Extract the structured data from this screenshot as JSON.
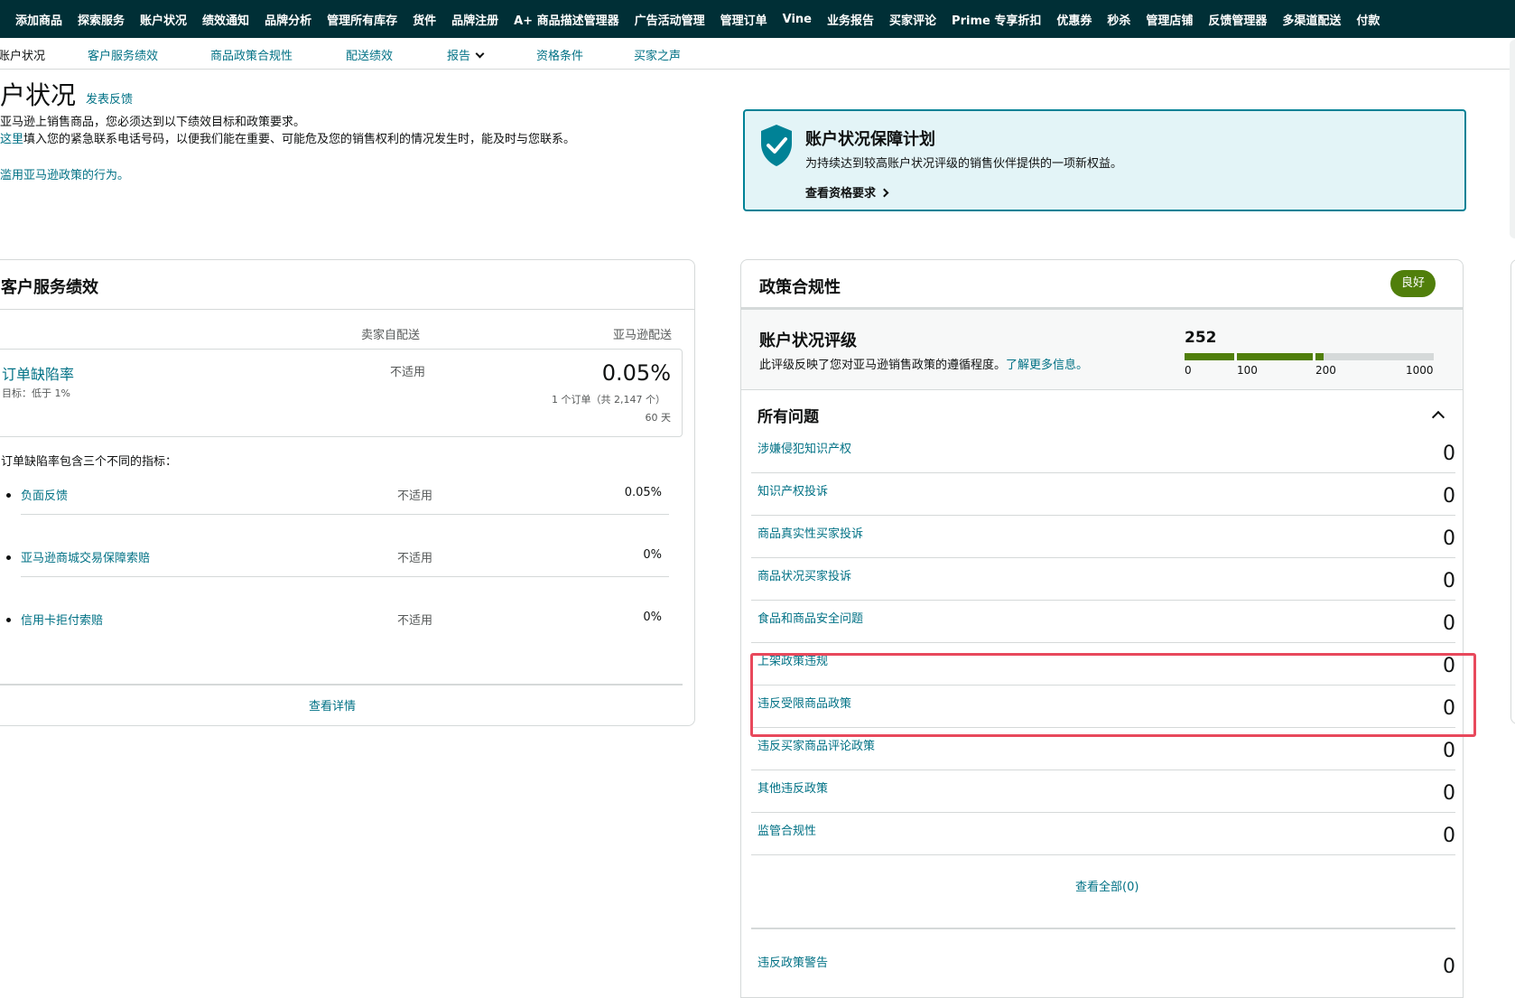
{
  "topnav": [
    "添加商品",
    "探索服务",
    "账户状况",
    "绩效通知",
    "品牌分析",
    "管理所有库存",
    "货件",
    "品牌注册",
    "A+ 商品描述管理器",
    "广告活动管理",
    "管理订单",
    "Vine",
    "业务报告",
    "买家评论",
    "Prime 专享折扣",
    "优惠券",
    "秒杀",
    "管理店铺",
    "反馈管理器",
    "多渠道配送",
    "付款"
  ],
  "subnav": {
    "account_health": "账户状况",
    "customer_service": "客户服务绩效",
    "policy_compliance": "商品政策合规性",
    "shipping": "配送绩效",
    "reports": "报告",
    "eligibility": "资格条件",
    "voice_of_buyer": "买家之声"
  },
  "header": {
    "title": "户状况",
    "feedback": "发表反馈",
    "intro_line1": "亚马逊上销售商品，您必须达到以下绩效目标和政策要求。",
    "intro_link": "这里",
    "intro_line2": "填入您的紧急联系电话号码，以便我们能在重要、可能危及您的销售权利的情况发生时，能及时与您联系。",
    "intro_line3": "滥用亚马逊政策的行为。"
  },
  "banner": {
    "title": "账户状况保障计划",
    "desc": "为持续达到较高账户状况评级的销售伙伴提供的一项新权益。",
    "link": "查看资格要求"
  },
  "customer_service": {
    "title": "客户服务绩效",
    "col_seller": "卖家自配送",
    "col_amazon": "亚马逊配送",
    "odr": {
      "name": "订单缺陷率",
      "target": "目标：低于 1%",
      "seller_value": "不适用",
      "amazon_value": "0.05%",
      "orders": "1 个订单（共 2,147 个）",
      "period": "60 天"
    },
    "note": "订单缺陷率包含三个不同的指标：",
    "metrics": [
      {
        "name": "负面反馈",
        "seller": "不适用",
        "amazon": "0.05%"
      },
      {
        "name": "亚马逊商城交易保障索赔",
        "seller": "不适用",
        "amazon": "0%"
      },
      {
        "name": "信用卡拒付索赔",
        "seller": "不适用",
        "amazon": "0%"
      }
    ],
    "details": "查看详情"
  },
  "policy": {
    "title": "政策合规性",
    "status": "良好",
    "rating_title": "账户状况评级",
    "rating_desc": "此评级反映了您对亚马逊销售政策的遵循程度。",
    "rating_link": "了解更多信息。",
    "score": "252",
    "score_value": 252,
    "scale": [
      "0",
      "100",
      "200",
      "1000"
    ],
    "issues_title": "所有问题",
    "issues": [
      {
        "name": "涉嫌侵犯知识产权",
        "count": "0"
      },
      {
        "name": "知识产权投诉",
        "count": "0"
      },
      {
        "name": "商品真实性买家投诉",
        "count": "0"
      },
      {
        "name": "商品状况买家投诉",
        "count": "0"
      },
      {
        "name": "食品和商品安全问题",
        "count": "0"
      },
      {
        "name": "上架政策违规",
        "count": "0"
      },
      {
        "name": "违反受限商品政策",
        "count": "0"
      },
      {
        "name": "违反买家商品评论政策",
        "count": "0"
      },
      {
        "name": "其他违反政策",
        "count": "0"
      },
      {
        "name": "监管合规性",
        "count": "0"
      }
    ],
    "view_all": "查看全部(0)",
    "warning": {
      "name": "违反政策警告",
      "count": "0"
    }
  },
  "colors": {
    "nav_bg": "#002f36",
    "link": "#007185",
    "good": "#507f0b",
    "highlight": "#e8495c",
    "banner_bg": "#e3f4f7"
  }
}
